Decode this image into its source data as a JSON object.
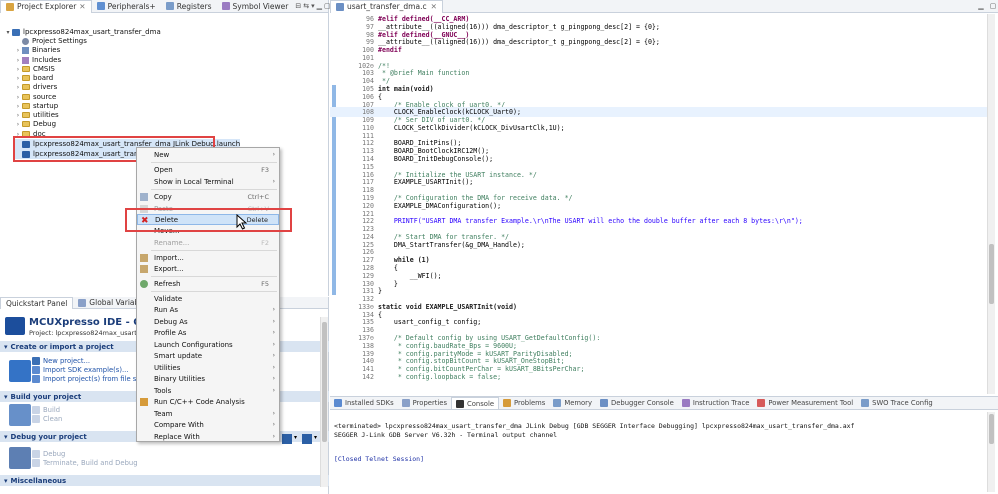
{
  "explorer": {
    "tabs": [
      "Project Explorer",
      "Peripherals+",
      "Registers",
      "Symbol Viewer"
    ],
    "project": "lpcxpresso824max_usart_transfer_dma",
    "items": [
      "Project Settings",
      "Binaries",
      "Includes",
      "CMSIS",
      "board",
      "drivers",
      "source",
      "startup",
      "utilities",
      "Debug",
      "doc"
    ],
    "launch_files": [
      "lpcxpresso824max_usart_transfer_dma JLink Debug.launch",
      "lpcxpresso824max_usart_transfer_dma"
    ]
  },
  "context_menu": {
    "items": [
      {
        "label": "New",
        "shortcut": "",
        "submenu": true,
        "disabled": false
      },
      {
        "label": "Open",
        "shortcut": "F3",
        "submenu": false,
        "disabled": false
      },
      {
        "label": "Show in Local Terminal",
        "shortcut": "",
        "submenu": true,
        "disabled": false
      },
      {
        "label": "Copy",
        "shortcut": "Ctrl+C",
        "submenu": false,
        "disabled": false
      },
      {
        "label": "Paste",
        "shortcut": "Ctrl+V",
        "submenu": false,
        "disabled": true
      },
      {
        "label": "Delete",
        "shortcut": "Delete",
        "submenu": false,
        "disabled": false,
        "highlighted": true
      },
      {
        "label": "Move...",
        "shortcut": "",
        "submenu": false,
        "disabled": false
      },
      {
        "label": "Rename...",
        "shortcut": "F2",
        "submenu": false,
        "disabled": true
      },
      {
        "label": "Import...",
        "shortcut": "",
        "submenu": false,
        "disabled": false
      },
      {
        "label": "Export...",
        "shortcut": "",
        "submenu": false,
        "disabled": false
      },
      {
        "label": "Refresh",
        "shortcut": "F5",
        "submenu": false,
        "disabled": false
      },
      {
        "label": "Validate",
        "shortcut": "",
        "submenu": false,
        "disabled": false
      },
      {
        "label": "Run As",
        "shortcut": "",
        "submenu": true,
        "disabled": false
      },
      {
        "label": "Debug As",
        "shortcut": "",
        "submenu": true,
        "disabled": false
      },
      {
        "label": "Profile As",
        "shortcut": "",
        "submenu": true,
        "disabled": false
      },
      {
        "label": "Launch Configurations",
        "shortcut": "",
        "submenu": true,
        "disabled": false
      },
      {
        "label": "Smart update",
        "shortcut": "",
        "submenu": true,
        "disabled": false
      },
      {
        "label": "Utilities",
        "shortcut": "",
        "submenu": true,
        "disabled": false
      },
      {
        "label": "Binary Utilities",
        "shortcut": "",
        "submenu": true,
        "disabled": false
      },
      {
        "label": "Tools",
        "shortcut": "",
        "submenu": true,
        "disabled": false
      },
      {
        "label": "Run C/C++ Code Analysis",
        "shortcut": "",
        "submenu": false,
        "disabled": false
      },
      {
        "label": "Team",
        "shortcut": "",
        "submenu": true,
        "disabled": false
      },
      {
        "label": "Compare With",
        "shortcut": "",
        "submenu": true,
        "disabled": false
      },
      {
        "label": "Replace With",
        "shortcut": "",
        "submenu": true,
        "disabled": false
      }
    ]
  },
  "quickstart": {
    "tabs": [
      "Quickstart Panel",
      "Global Variables"
    ],
    "title": "MCUXpresso IDE - Quickst",
    "project_line": "Project: lpcxpresso824max_usart_transf",
    "sections": {
      "create": "Create or import a project",
      "build": "Build your project",
      "debug": "Debug your project",
      "misc": "Miscellaneous"
    },
    "links": {
      "new_project": "New project...",
      "import_sdk": "Import SDK example(s)...",
      "import_fs": "Import project(s) from file system...",
      "build": "Build",
      "clean": "Clean",
      "debug": "Debug",
      "terminate": "Terminate, Build and Debug"
    }
  },
  "editor": {
    "tab": "usart_transfer_dma.c",
    "lines": [
      {
        "n": "96",
        "t": "#elif defined(__CC_ARM)",
        "k": "pp"
      },
      {
        "n": "97",
        "t": "__attribute__((aligned(16))) dma_descriptor_t g_pingpong_desc[2] = {0};",
        "k": "code"
      },
      {
        "n": "98",
        "t": "#elif defined(__GNUC__)",
        "k": "pp"
      },
      {
        "n": "99",
        "t": "__attribute__((aligned(16))) dma_descriptor_t g_pingpong_desc[2] = {0};",
        "k": "code"
      },
      {
        "n": "100",
        "t": "#endif",
        "k": "pp"
      },
      {
        "n": "101",
        "t": "",
        "k": "code"
      },
      {
        "n": "102⊖",
        "t": "/*!",
        "k": "cm"
      },
      {
        "n": "103",
        "t": " * @brief Main function",
        "k": "cm"
      },
      {
        "n": "104",
        "t": " */",
        "k": "cm"
      },
      {
        "n": "105",
        "t": "int main(void)",
        "k": "main"
      },
      {
        "n": "106",
        "t": "{",
        "k": "code"
      },
      {
        "n": "107",
        "t": "    /* Enable clock of uart0. */",
        "k": "cm"
      },
      {
        "n": "108",
        "t": "    CLOCK_EnableClock(kCLOCK_Uart0);",
        "k": "cur"
      },
      {
        "n": "109",
        "t": "    /* Ser DIV of uart0. */",
        "k": "cm"
      },
      {
        "n": "110",
        "t": "    CLOCK_SetClkDivider(kCLOCK_DivUsartClk,1U);",
        "k": "code"
      },
      {
        "n": "111",
        "t": "",
        "k": "code"
      },
      {
        "n": "112",
        "t": "    BOARD_InitPins();",
        "k": "code"
      },
      {
        "n": "113",
        "t": "    BOARD_BootClockIRC12M();",
        "k": "code"
      },
      {
        "n": "114",
        "t": "    BOARD_InitDebugConsole();",
        "k": "code"
      },
      {
        "n": "115",
        "t": "",
        "k": "code"
      },
      {
        "n": "116",
        "t": "    /* Initialize the USART instance. */",
        "k": "cm"
      },
      {
        "n": "117",
        "t": "    EXAMPLE_USARTInit();",
        "k": "code"
      },
      {
        "n": "118",
        "t": "",
        "k": "code"
      },
      {
        "n": "119",
        "t": "    /* Configuration the DMA for receive data. */",
        "k": "cm"
      },
      {
        "n": "120",
        "t": "    EXAMPLE_DMAConfiguration();",
        "k": "code"
      },
      {
        "n": "121",
        "t": "",
        "k": "code"
      },
      {
        "n": "122",
        "t": "    PRINTF(\"USART DMA transfer Example.\\r\\nThe USART will echo the double buffer after each 8 bytes:\\r\\n\");",
        "k": "str"
      },
      {
        "n": "123",
        "t": "",
        "k": "code"
      },
      {
        "n": "124",
        "t": "    /* Start DMA for transfer. */",
        "k": "cm"
      },
      {
        "n": "125",
        "t": "    DMA_StartTransfer(&g_DMA_Handle);",
        "k": "code"
      },
      {
        "n": "126",
        "t": "",
        "k": "code"
      },
      {
        "n": "127",
        "t": "    while (1)",
        "k": "while"
      },
      {
        "n": "128",
        "t": "    {",
        "k": "code"
      },
      {
        "n": "129",
        "t": "        __WFI();",
        "k": "code"
      },
      {
        "n": "130",
        "t": "    }",
        "k": "code"
      },
      {
        "n": "131",
        "t": "}",
        "k": "code"
      },
      {
        "n": "132",
        "t": "",
        "k": "code"
      },
      {
        "n": "133⊖",
        "t": "static void EXAMPLE_USARTInit(void)",
        "k": "static"
      },
      {
        "n": "134",
        "t": "{",
        "k": "code"
      },
      {
        "n": "135",
        "t": "    usart_config_t config;",
        "k": "code"
      },
      {
        "n": "136",
        "t": "",
        "k": "code"
      },
      {
        "n": "137⊖",
        "t": "    /* Default config by using USART_GetDefaultConfig():",
        "k": "cm"
      },
      {
        "n": "138",
        "t": "     * config.baudRate_Bps = 9600U;",
        "k": "cm"
      },
      {
        "n": "139",
        "t": "     * config.parityMode = kUSART_ParityDisabled;",
        "k": "cm"
      },
      {
        "n": "140",
        "t": "     * config.stopBitCount = kUSART_OneStopBit;",
        "k": "cm"
      },
      {
        "n": "141",
        "t": "     * config.bitCountPerChar = kUSART_8BitsPerChar;",
        "k": "cm"
      },
      {
        "n": "142",
        "t": "     * config.loopback = false;",
        "k": "cm"
      }
    ]
  },
  "console": {
    "tabs": [
      "Installed SDKs",
      "Properties",
      "Console",
      "Problems",
      "Memory",
      "Debugger Console",
      "Instruction Trace",
      "Power Measurement Tool",
      "SWO Trace Config"
    ],
    "lines": [
      "<terminated> lpcxpresso824max_usart_transfer_dma JLink Debug [GDB SEGGER Interface Debugging] lpcxpresso824max_usart_transfer_dma.axf",
      "SEGGER J-Link GDB Server V6.32h - Terminal output channel",
      "",
      "[Closed Telnet Session]"
    ]
  }
}
